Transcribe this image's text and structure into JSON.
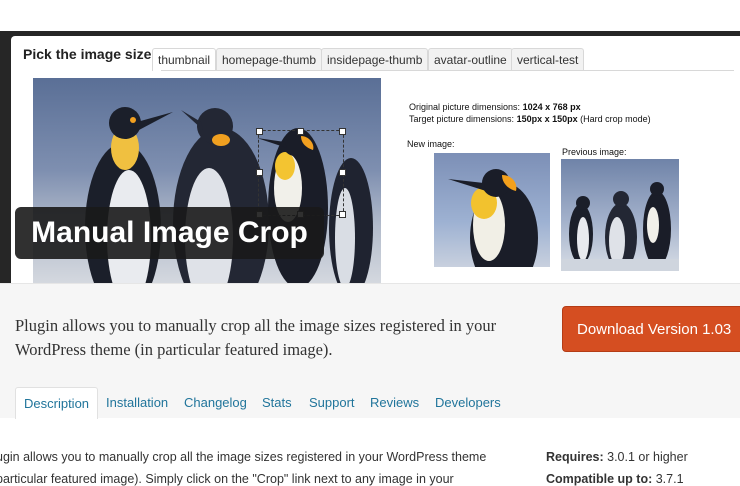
{
  "banner": {
    "pick_label": "Pick the image size:",
    "size_tabs": [
      "thumbnail",
      "homepage-thumb",
      "insidepage-thumb",
      "avatar-outline",
      "vertical-test"
    ],
    "original_dims_label": "Original picture dimensions: ",
    "original_dims_value": "1024 x 768 px",
    "target_dims_label": "Target picture dimensions: ",
    "target_dims_value": "150px x 150px",
    "target_dims_note": " (Hard crop mode)",
    "new_image_label": "New image:",
    "previous_image_label": "Previous image:",
    "overlay_title": "Manual Image Crop"
  },
  "plugin": {
    "short_description": "Plugin allows you to manually crop all the image sizes registered in your WordPress theme (in particular featured image).",
    "download_label": "Download Version 1.03",
    "tabs": [
      "Description",
      "Installation",
      "Changelog",
      "Stats",
      "Support",
      "Reviews",
      "Developers"
    ]
  },
  "body": {
    "line1": "ugin allows you to manually crop all the image sizes registered in your WordPress theme",
    "line2": " particular featured image). Simply click on the \"Crop\" link next to any image in your"
  },
  "meta": {
    "requires_label": "Requires:",
    "requires_value": " 3.0.1 or higher",
    "compatible_label": "Compatible up to:",
    "compatible_value": " 3.7.1"
  },
  "colors": {
    "accent": "#d54e21",
    "link": "#21759b",
    "overlay": "#191919"
  }
}
